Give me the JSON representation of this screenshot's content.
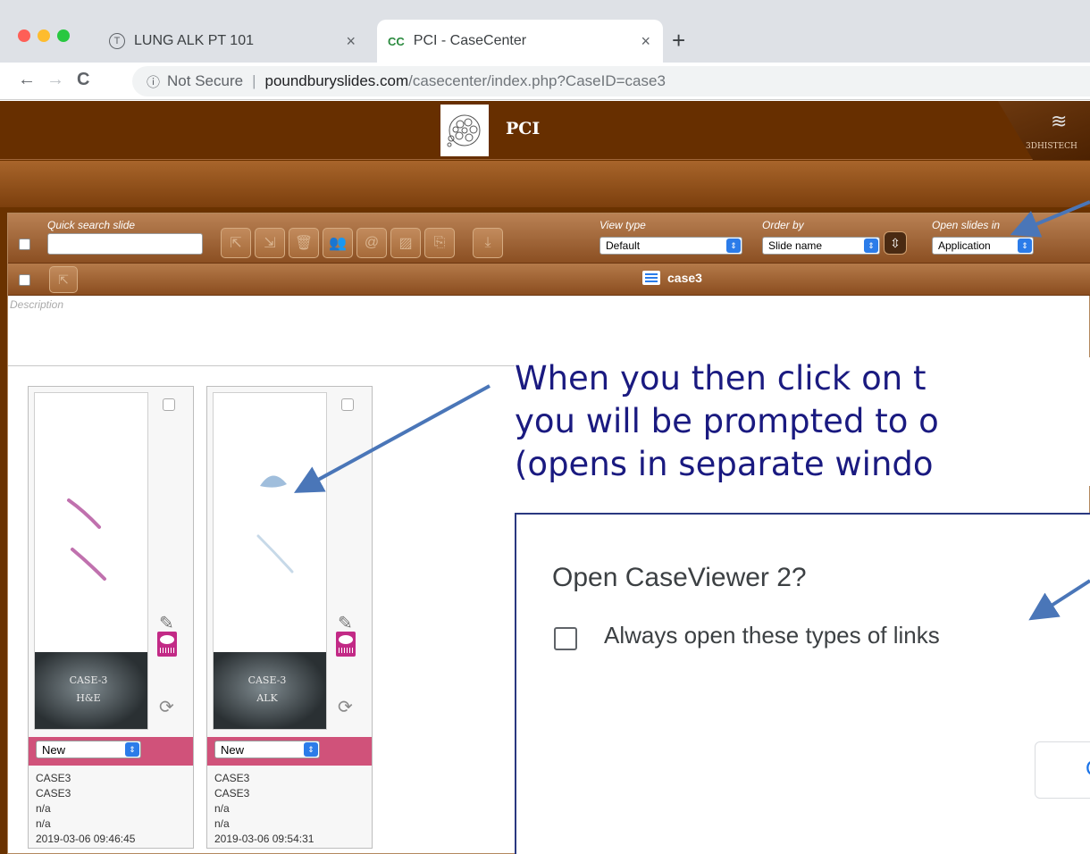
{
  "browser": {
    "tabs": [
      {
        "title": "LUNG ALK PT 101",
        "icon_letter": "T",
        "active": false
      },
      {
        "title": "PCI - CaseCenter",
        "icon_letter": "CC",
        "active": true
      }
    ],
    "new_tab": "+",
    "nav": {
      "back": "←",
      "forward": "→",
      "reload": "C"
    },
    "url": {
      "info": "ⓘ",
      "security": "Not Secure",
      "host": "poundburyslides.com",
      "path": "/casecenter/index.php?CaseID=case3"
    }
  },
  "app": {
    "title": "PCI",
    "brand": "3DHISTECH",
    "toolbar": {
      "quick_search_label": "Quick search slide",
      "view_type_label": "View type",
      "view_type_value": "Default",
      "order_by_label": "Order by",
      "order_by_value": "Slide name",
      "open_slides_label": "Open slides in",
      "open_slides_value": "Application"
    },
    "case_name": "case3",
    "description_placeholder": "Description",
    "slides": [
      {
        "label_lines": [
          "CASE-3",
          "H&E"
        ],
        "status": "New",
        "meta": [
          "CASE3",
          "CASE3",
          "n/a",
          "n/a",
          "2019-03-06 09:46:45"
        ]
      },
      {
        "label_lines": [
          "CASE-3",
          "ALK"
        ],
        "status": "New",
        "meta": [
          "CASE3",
          "CASE3",
          "n/a",
          "n/a",
          "2019-03-06 09:54:31"
        ]
      }
    ]
  },
  "overlay": {
    "callout_lines": [
      "When you then click on t",
      "you will be prompted to o",
      "(opens in separate windo"
    ],
    "dialog": {
      "title": "Open CaseViewer 2?",
      "checkbox_label": "Always open these types of links",
      "button_label": "C"
    }
  },
  "colors": {
    "app_brown": "#672f00",
    "status_pink": "#d0527a",
    "callout_text": "#1a1a80",
    "arrow_blue": "#4a76b8"
  }
}
